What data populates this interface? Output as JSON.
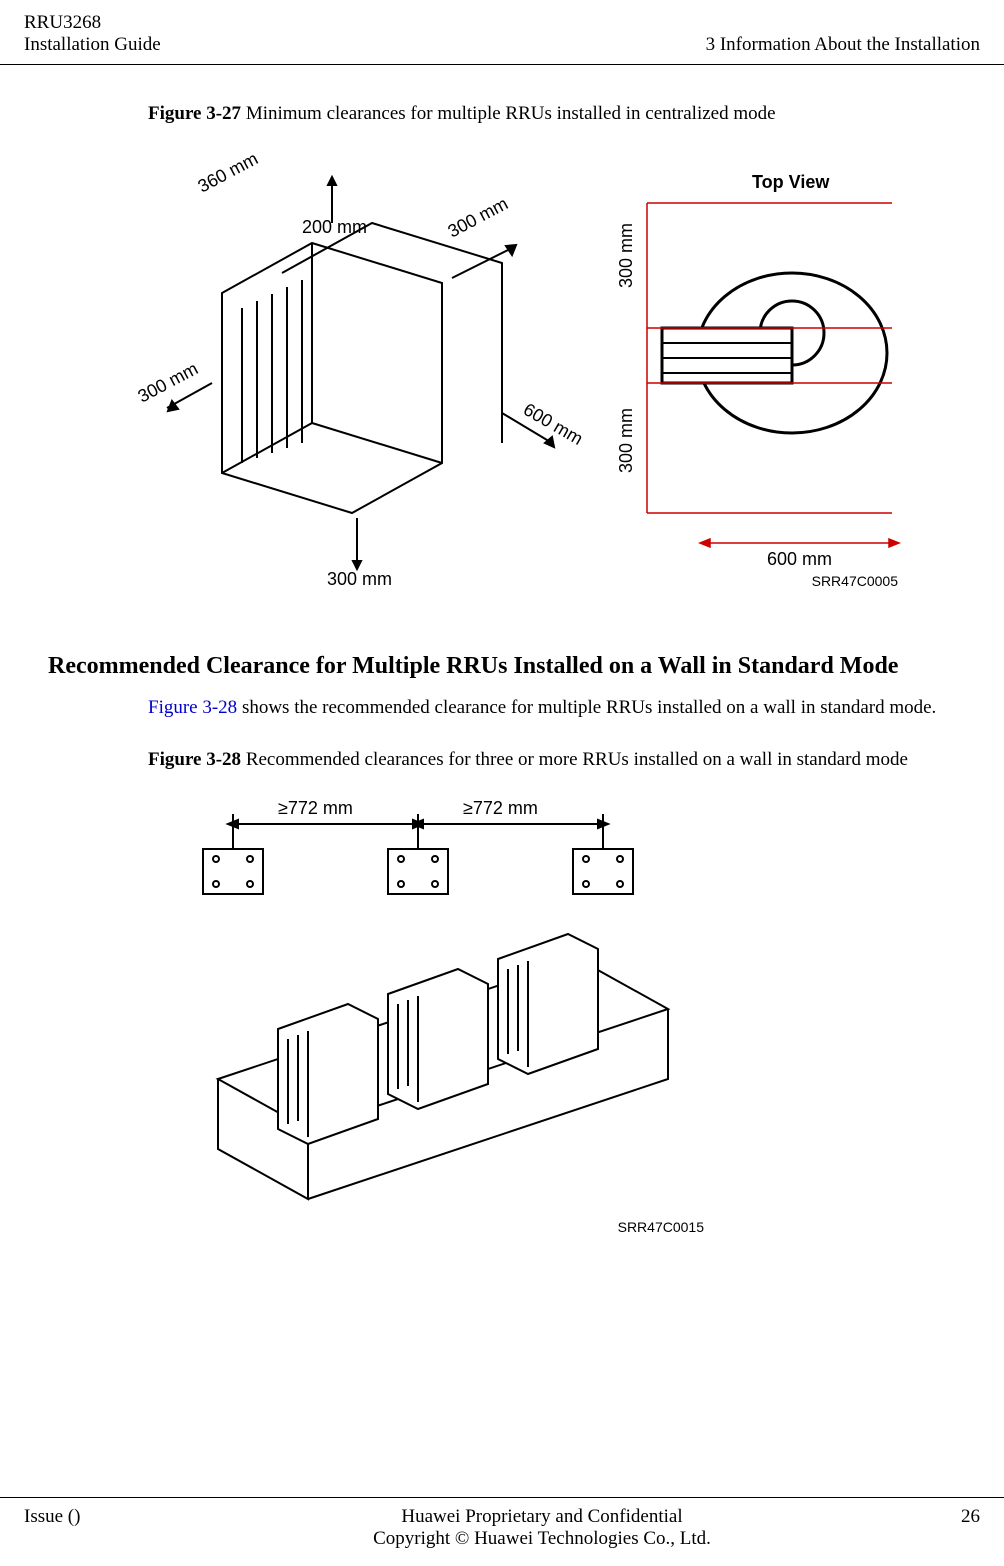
{
  "header": {
    "doc_title": "RRU3268",
    "doc_subtitle": "Installation Guide",
    "chapter": "3 Information About the Installation"
  },
  "figure27": {
    "label": "Figure 3-27",
    "caption": " Minimum clearances for multiple RRUs installed in centralized mode",
    "dims": {
      "d360": "360 mm",
      "d200": "200 mm",
      "d300a": "300 mm",
      "d300b": "300 mm",
      "d300c": "300 mm",
      "d600": "600 mm",
      "top_view": "Top View",
      "tv_300a": "300 mm",
      "tv_300b": "300 mm",
      "tv_600": "600 mm"
    },
    "image_id": "SRR47C0005"
  },
  "section": {
    "heading": "Recommended Clearance for Multiple RRUs Installed on a Wall in Standard Mode",
    "link_text": "Figure 3-28",
    "body": " shows the recommended clearance for multiple RRUs installed on a wall in standard mode."
  },
  "figure28": {
    "label": "Figure 3-28",
    "caption": " Recommended clearances for three or more RRUs installed on a wall in standard mode",
    "dims": {
      "ge772a": "≥772 mm",
      "ge772b": "≥772 mm"
    },
    "image_id": "SRR47C0015"
  },
  "footer": {
    "issue": "Issue ()",
    "line1": "Huawei Proprietary and Confidential",
    "line2": "Copyright © Huawei Technologies Co., Ltd.",
    "page": "26"
  }
}
